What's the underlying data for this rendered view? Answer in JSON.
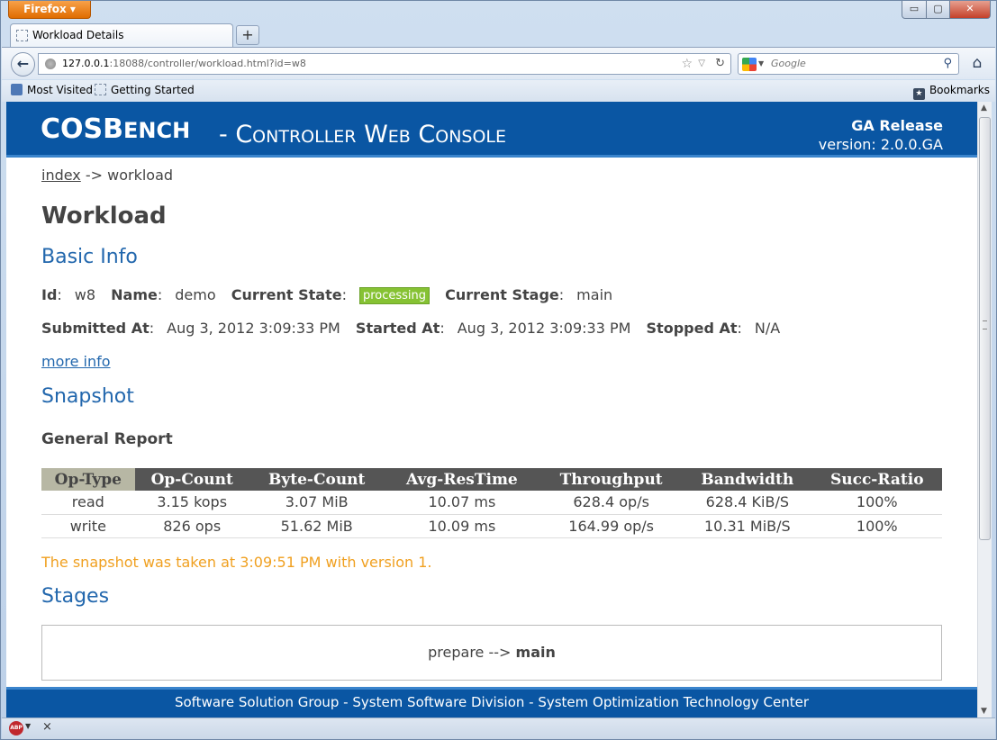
{
  "browser": {
    "menu_button": "Firefox",
    "tab_title": "Workload Details",
    "new_tab": "+",
    "url_host": "127.0.0.1",
    "url_rest": ":18088/controller/workload.html?id=w8",
    "search_placeholder": "Google",
    "bookmarks": {
      "most_visited": "Most Visited",
      "getting_started": "Getting Started",
      "bookmarks": "Bookmarks"
    },
    "window_controls": {
      "minimize": "▭",
      "maximize": "▢",
      "close": "✕"
    }
  },
  "header": {
    "logo_cos": "COS",
    "logo_b": "B",
    "logo_ench": "ENCH",
    "subtitle": "- Controller Web Console",
    "release": "GA Release",
    "version": "version: 2.0.0.GA"
  },
  "breadcrumb": {
    "index": "index",
    "sep": " -> ",
    "current": "workload"
  },
  "title": "Workload",
  "basic_info": {
    "heading": "Basic Info",
    "id_label": "Id",
    "id_value": "w8",
    "name_label": "Name",
    "name_value": "demo",
    "state_label": "Current State",
    "state_value": "processing",
    "stage_label": "Current Stage",
    "stage_value": "main",
    "submitted_label": "Submitted At",
    "submitted_value": "Aug 3, 2012 3:09:33 PM",
    "started_label": "Started At",
    "started_value": "Aug 3, 2012 3:09:33 PM",
    "stopped_label": "Stopped At",
    "stopped_value": "N/A",
    "more_info": "more info"
  },
  "snapshot": {
    "heading": "Snapshot",
    "report_heading": "General Report",
    "columns": [
      "Op-Type",
      "Op-Count",
      "Byte-Count",
      "Avg-ResTime",
      "Throughput",
      "Bandwidth",
      "Succ-Ratio"
    ],
    "rows": [
      [
        "read",
        "3.15 kops",
        "3.07 MiB",
        "10.07 ms",
        "628.4 op/s",
        "628.4 KiB/S",
        "100%"
      ],
      [
        "write",
        "826 ops",
        "51.62 MiB",
        "10.09 ms",
        "164.99 op/s",
        "10.31 MiB/S",
        "100%"
      ]
    ],
    "note": "The snapshot was taken at 3:09:51 PM with version 1."
  },
  "stages": {
    "heading": "Stages",
    "prepare": "prepare",
    "arrow": " --> ",
    "main": "main"
  },
  "footer": "Software Solution Group - System Software Division - System Optimization Technology Center",
  "colors": {
    "header_blue": "#0a56a3",
    "heading_blue": "#2267ad",
    "badge_green": "#86c233",
    "note_orange": "#f0a020",
    "table_header": "#555555",
    "table_first_header": "#b7b7a4"
  }
}
